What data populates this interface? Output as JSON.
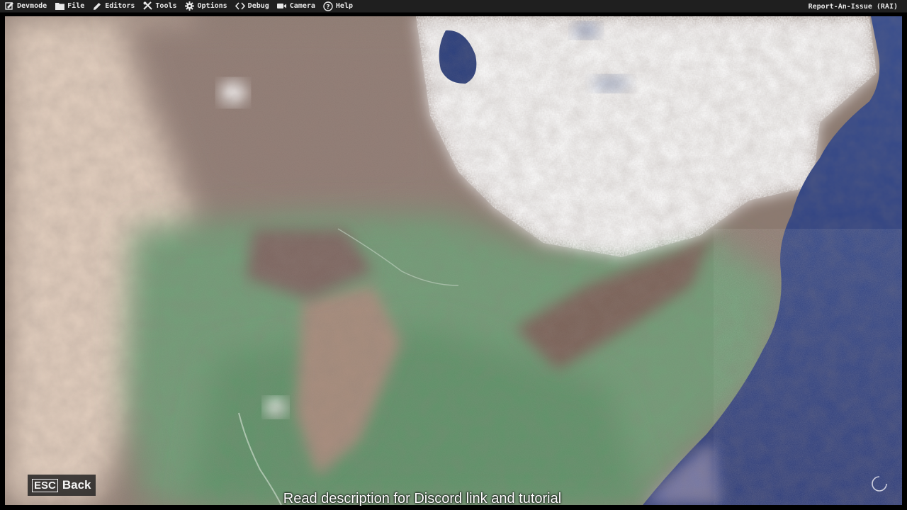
{
  "menubar": {
    "items": [
      {
        "label": "Devmode",
        "icon": "devmode-icon"
      },
      {
        "label": "File",
        "icon": "folder-icon"
      },
      {
        "label": "Editors",
        "icon": "pencil-icon"
      },
      {
        "label": "Tools",
        "icon": "tools-icon"
      },
      {
        "label": "Options",
        "icon": "gear-icon"
      },
      {
        "label": "Debug",
        "icon": "code-brackets-icon"
      },
      {
        "label": "Camera",
        "icon": "camera-icon"
      },
      {
        "label": "Help",
        "icon": "help-circle-icon"
      }
    ],
    "right_label": "Report-An-Issue (RAI)"
  },
  "viewport": {
    "scene": "satellite-terrain-map"
  },
  "esc_back": {
    "key": "ESC",
    "label": "Back"
  },
  "caption": "Read description for Discord link and tutorial",
  "colors": {
    "menubar_bg": "#1f1f1f",
    "ocean": "#2e3f7a",
    "land_green": "#6e9a72",
    "land_brown": "#8a7468",
    "land_desert": "#d8c2b0",
    "cloud": "#f2f2f2"
  }
}
